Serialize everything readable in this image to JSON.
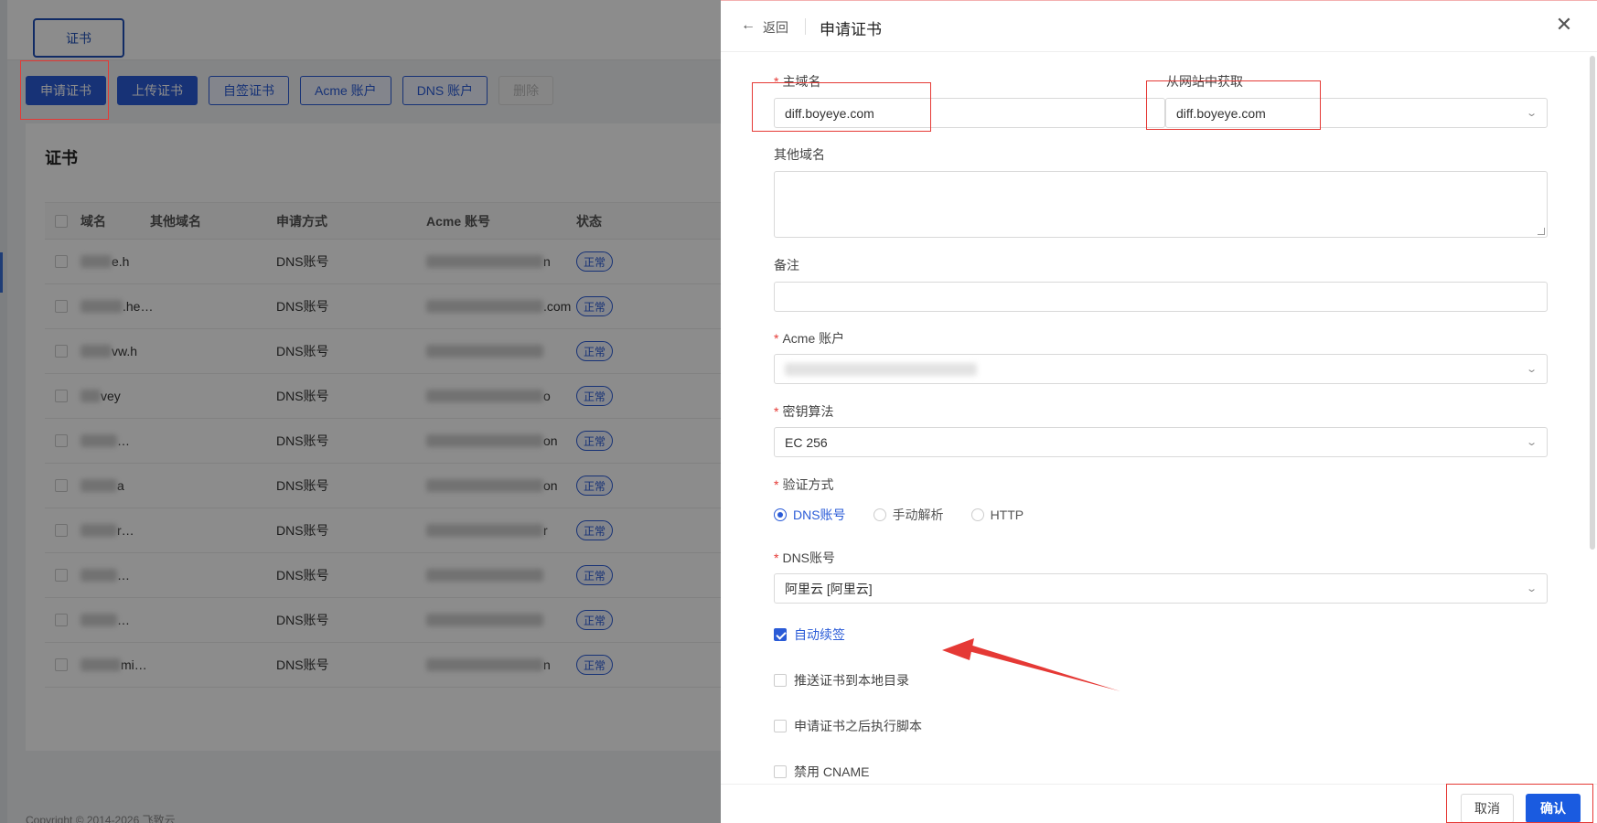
{
  "background": {
    "top_tab": "证书",
    "toolbar": {
      "apply": "申请证书",
      "upload": "上传证书",
      "self_signed": "自签证书",
      "acme_account": "Acme 账户",
      "dns_account": "DNS 账户",
      "delete": "删除"
    },
    "card_title": "证书",
    "table": {
      "headers": [
        "域名",
        "其他域名",
        "申请方式",
        "Acme 账号",
        "状态"
      ],
      "rows": [
        {
          "domain": "e.h",
          "method": "DNS账号",
          "acme": "n",
          "status": "正常"
        },
        {
          "domain": ".he…",
          "method": "DNS账号",
          "acme": ".com",
          "status": "正常"
        },
        {
          "domain": "vw.h",
          "method": "DNS账号",
          "acme": "",
          "status": "正常"
        },
        {
          "domain": "vey",
          "method": "DNS账号",
          "acme": "o",
          "status": "正常"
        },
        {
          "domain": "…",
          "method": "DNS账号",
          "acme": "on",
          "status": "正常"
        },
        {
          "domain": "a",
          "method": "DNS账号",
          "acme": "on",
          "status": "正常"
        },
        {
          "domain": "r…",
          "method": "DNS账号",
          "acme": "r",
          "status": "正常"
        },
        {
          "domain": "…",
          "method": "DNS账号",
          "acme": "",
          "status": "正常"
        },
        {
          "domain": "…",
          "method": "DNS账号",
          "acme": "",
          "status": "正常"
        },
        {
          "domain": "mi…",
          "method": "DNS账号",
          "acme": "n",
          "status": "正常"
        }
      ]
    },
    "footer": "Copyright © 2014-2026 飞致云"
  },
  "drawer": {
    "back": "返回",
    "title": "申请证书",
    "fields": {
      "main_domain": {
        "label": "主域名",
        "value": "diff.boyeye.com"
      },
      "from_website": {
        "label": "从网站中获取",
        "value": "diff.boyeye.com"
      },
      "other_domains": {
        "label": "其他域名",
        "value": ""
      },
      "remark": {
        "label": "备注",
        "value": ""
      },
      "acme_account": {
        "label": "Acme 账户",
        "value": ""
      },
      "key_algorithm": {
        "label": "密钥算法",
        "value": "EC 256"
      },
      "verify_method": {
        "label": "验证方式",
        "options": [
          "DNS账号",
          "手动解析",
          "HTTP"
        ],
        "selected": "DNS账号"
      },
      "dns_account": {
        "label": "DNS账号",
        "value": "阿里云 [阿里云]"
      }
    },
    "checkboxes": [
      {
        "label": "自动续签",
        "checked": true
      },
      {
        "label": "推送证书到本地目录",
        "checked": false
      },
      {
        "label": "申请证书之后执行脚本",
        "checked": false
      },
      {
        "label": "禁用 CNAME",
        "checked": false
      }
    ],
    "cancel": "取消",
    "confirm": "确认"
  },
  "colors": {
    "accent": "#2a5bd7",
    "annotation": "#e53935"
  }
}
